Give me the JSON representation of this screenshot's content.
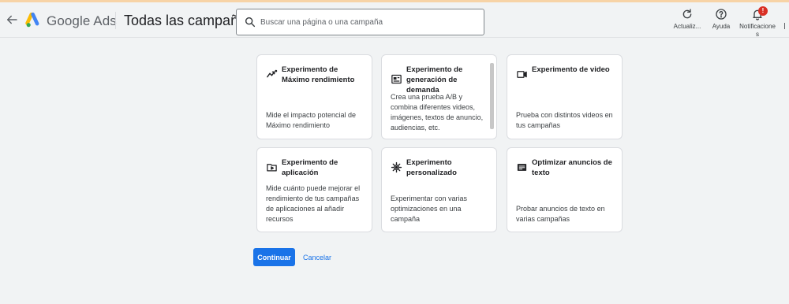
{
  "app": {
    "brand": "Google Ads",
    "page_title": "Todas las campañas"
  },
  "search": {
    "placeholder": "Buscar una página o una campaña",
    "value": ""
  },
  "toolbar": {
    "refresh_label": "Actualiz...",
    "help_label": "Ayuda",
    "notifications_label": "Notificaciones",
    "notifications_badge": "!"
  },
  "cards": [
    {
      "title": "Experimento de Máximo rendimiento",
      "description": "Mide el impacto potencial de Máximo rendimiento",
      "icon": "trend-icon"
    },
    {
      "title": "Experimento de generación de demanda",
      "description": "Crea una prueba A/B y combina diferentes videos, imágenes, textos de anuncio, audiencias, etc.",
      "icon": "ad-image-icon"
    },
    {
      "title": "Experimento de video",
      "description": "Prueba con distintos videos en tus campañas",
      "icon": "video-icon"
    },
    {
      "title": "Experimento de aplicación",
      "description": "Mide cuánto puede mejorar el rendimiento de tus campañas de aplicaciones al añadir recursos",
      "icon": "app-folder-icon"
    },
    {
      "title": "Experimento personalizado",
      "description": "Experimentar con varias optimizaciones en una campaña",
      "icon": "gear-icon"
    },
    {
      "title": "Optimizar anuncios de texto",
      "description": "Probar anuncios de texto en varias campañas",
      "icon": "text-ad-icon"
    }
  ],
  "actions": {
    "continue_label": "Continuar",
    "cancel_label": "Cancelar"
  },
  "colors": {
    "accent": "#1a73e8",
    "badge": "#d93025",
    "background": "#f1f3f4"
  }
}
